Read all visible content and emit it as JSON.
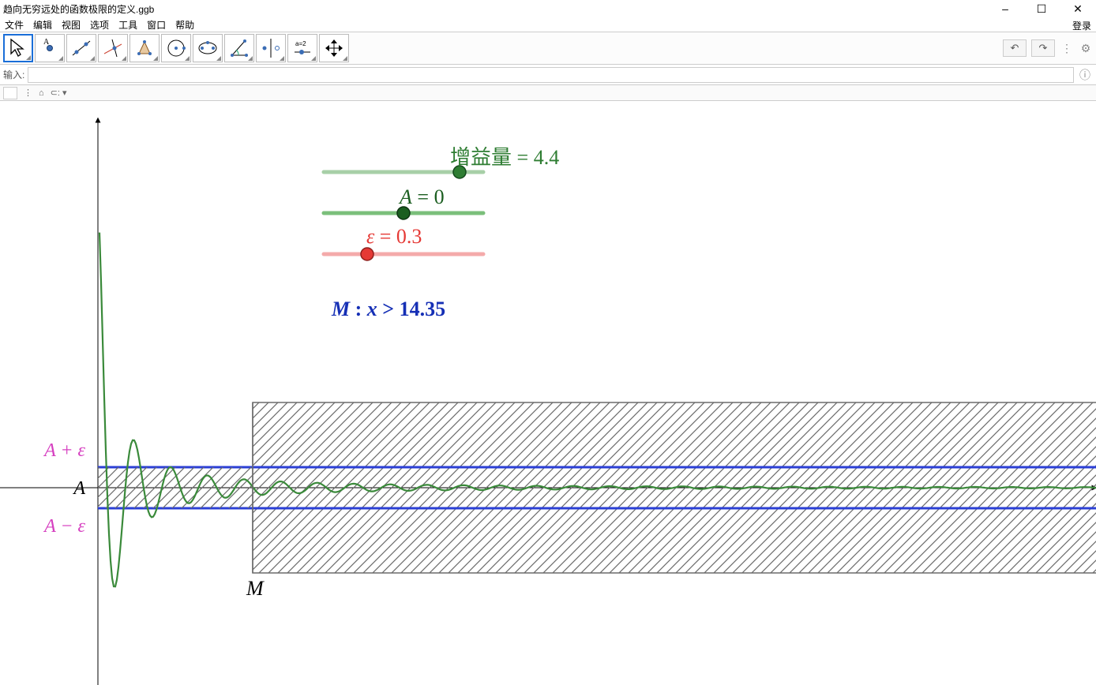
{
  "title": "趋向无穷远处的函数极限的定义.ggb",
  "window_controls": {
    "min": "–",
    "max": "☐",
    "close": "✕"
  },
  "menubar": [
    "文件",
    "编辑",
    "视图",
    "选项",
    "工具",
    "窗口",
    "帮助"
  ],
  "login_label": "登录",
  "toolbar": {
    "undo": "↶",
    "redo": "↷",
    "menu": "⋮",
    "settings": "⚙"
  },
  "tool_slider_text": "a=2",
  "inputbar": {
    "label": "输入:",
    "placeholder": ""
  },
  "sliders": {
    "gain": {
      "label": "增益量",
      "value": "4.4",
      "color": "#2e7d32",
      "pos": 0.85
    },
    "A": {
      "label": "A",
      "value": "0",
      "color": "#1b5e20",
      "pos": 0.5
    },
    "eps": {
      "label": "ε",
      "value": "0.3",
      "color": "#e53935",
      "pos": 0.27
    }
  },
  "M_text": {
    "prefix": "M",
    "colon": " : ",
    "var": "x",
    "op": " > ",
    "value": "14.35"
  },
  "axis_labels": {
    "A_plus_eps": "A + ε",
    "A": "A",
    "A_minus_eps": "A − ε",
    "M_axis": "M"
  },
  "colors": {
    "curve": "#3a8a3a",
    "band": "#2b3fd6",
    "eps_label": "#d63fc0",
    "A_label": "#000",
    "slider_gain_track": "#a7cfa7",
    "slider_A_track": "#7bbf7b",
    "slider_eps_track": "#f4aaaa",
    "hatch": "#6b6b6b",
    "Mtext": "#152fb5"
  },
  "chart_data": {
    "type": "line",
    "title": "",
    "xlabel": "",
    "ylabel": "",
    "A": 0,
    "epsilon": 0.3,
    "M": 14.35,
    "note": "plot of a damped oscillating function approaching A as x→∞; horizontal band at A±ε; hatched region for x>M"
  }
}
